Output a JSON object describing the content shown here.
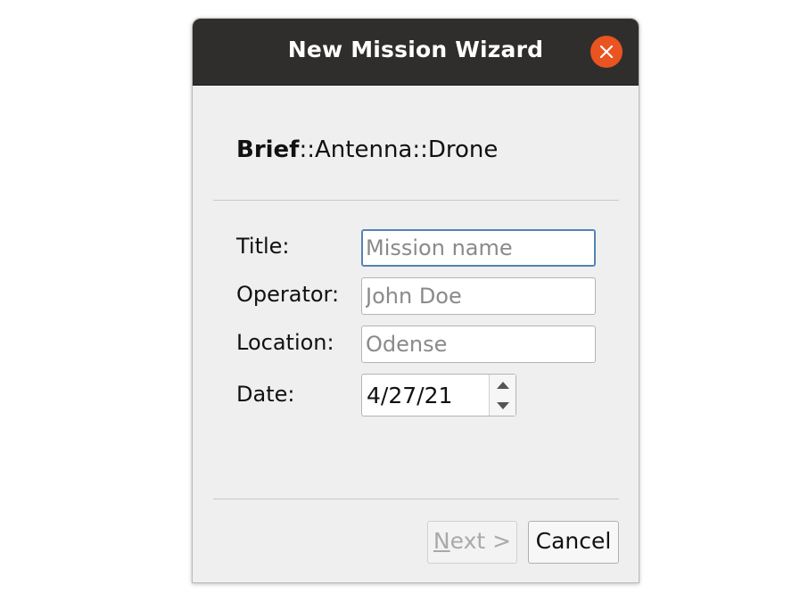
{
  "window": {
    "title": "New Mission Wizard"
  },
  "breadcrumb": {
    "current": "Brief",
    "rest": "::Antenna::Drone"
  },
  "form": {
    "title": {
      "label": "Title:",
      "value": "",
      "placeholder": "Mission name"
    },
    "operator": {
      "label": "Operator:",
      "value": "",
      "placeholder": "John Doe"
    },
    "location": {
      "label": "Location:",
      "value": "",
      "placeholder": "Odense"
    },
    "date": {
      "label": "Date:",
      "value": "4/27/21"
    }
  },
  "buttons": {
    "next": {
      "mnemonic": "N",
      "label_rest": "ext >",
      "enabled": false
    },
    "cancel": {
      "label": "Cancel"
    }
  },
  "colors": {
    "titlebar": "#302e2d",
    "close_button": "#e95420",
    "focus_border": "#5283b5"
  }
}
